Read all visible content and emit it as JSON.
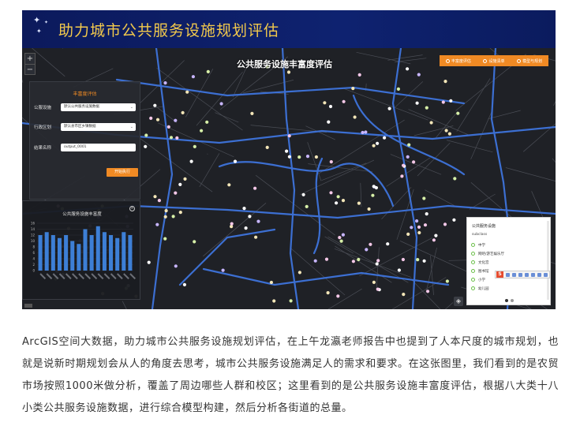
{
  "banner": {
    "title": "助力城市公共服务设施规划评估"
  },
  "map": {
    "title": "公共服务设施丰富度评估",
    "zoom_in": "+",
    "zoom_out": "−",
    "toolbar": [
      {
        "label": "丰富度评估"
      },
      {
        "label": "设施清单"
      },
      {
        "label": "模型与规划"
      }
    ]
  },
  "panel": {
    "title": "丰富度评估",
    "rows": [
      {
        "label": "公服设施",
        "value": "默认公共服务设施数据"
      },
      {
        "label": "行政区划",
        "value": "默认县市区乡镇数据"
      },
      {
        "label": "结果名称",
        "value": "output_0001"
      }
    ],
    "run_label": "开始执行"
  },
  "chart_panel": {
    "title": "公共服务设施丰富度",
    "close": "×"
  },
  "chart_data": {
    "type": "bar",
    "title": "公共服务设施丰富度",
    "ylim": [
      0,
      16
    ],
    "yticks": [
      "16",
      "14",
      "12",
      "10",
      "8",
      "6",
      "4",
      "2",
      "0"
    ],
    "values": [
      12,
      13,
      12,
      11,
      12,
      10,
      9,
      14,
      12,
      15,
      13,
      12,
      11,
      13,
      12
    ],
    "bar_color": "#3d7fd6"
  },
  "legend": {
    "title": "公共服务设施",
    "subtitle": "subclass",
    "items": [
      {
        "label": "中学"
      },
      {
        "label": "网吧/游艺娱乐厅"
      },
      {
        "label": "文化宫"
      },
      {
        "label": "图书馆"
      },
      {
        "label": "小学"
      },
      {
        "label": "幼儿园"
      }
    ]
  },
  "ime": {
    "s_label": "S"
  },
  "paragraph": {
    "text": "ArcGIS空间大数据，助力城市公共服务设施规划评估，在上午龙瀛老师报告中也提到了人本尺度的城市规划，也就是说新时期规划会从人的角度去思考，城市公共服务设施满足人的需求和要求。在这张图里，我们看到的是农贸市场按照1000米做分析，覆盖了周边哪些人群和校区；这里看到的是公共服务设施丰富度评估，根据八大类十八小类公共服务设施数据，进行综合模型构建，然后分析各街道的总量。"
  },
  "colors": {
    "banner_bg": "#0e2270",
    "banner_title": "#f2c94c",
    "accent": "#f08a24",
    "map_bg": "#1f2126",
    "road": "#3c6fd2"
  }
}
